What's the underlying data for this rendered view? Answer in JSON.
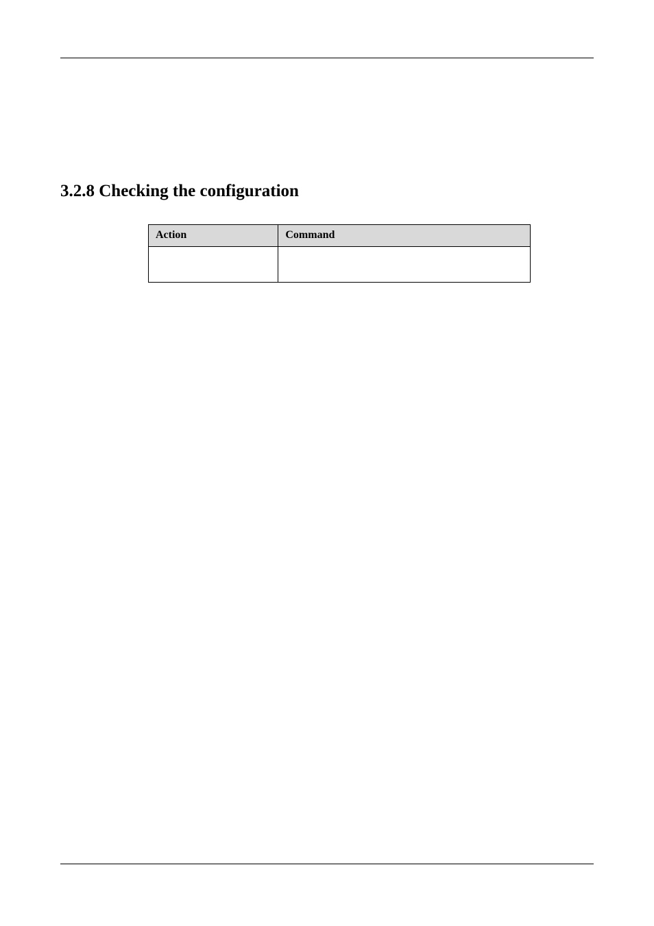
{
  "heading": "3.2.8 Checking the configuration",
  "table": {
    "headers": {
      "action": "Action",
      "command": "Command"
    },
    "rows": [
      {
        "action": "",
        "command": ""
      }
    ]
  }
}
